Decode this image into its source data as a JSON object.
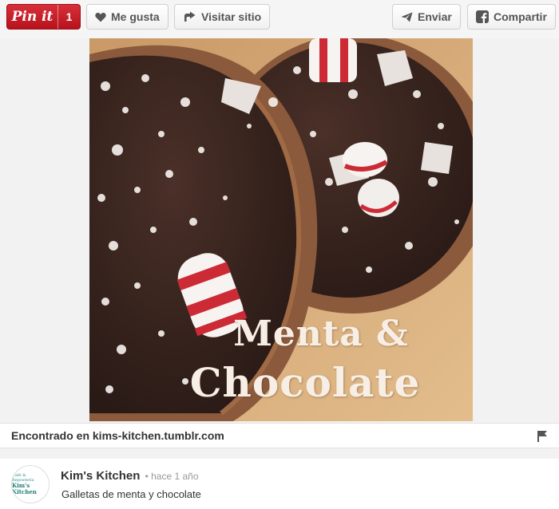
{
  "toolbar": {
    "pinit_label": "Pin it",
    "pinit_count": "1",
    "like_label": "Me gusta",
    "visit_label": "Visitar sitio",
    "send_label": "Enviar",
    "share_label": "Compartir"
  },
  "pin": {
    "overlay_line1": "Menta &",
    "overlay_line2": "Chocolate",
    "source_text": "Encontrado en kims-kitchen.tumblr.com"
  },
  "pinner": {
    "name": "Kim's Kitchen",
    "time": "• hace 1 año",
    "description": "Galletas de menta y chocolate",
    "avatar_small_text": "Café & Repostería",
    "avatar_main_text": "Kim's Kitchen"
  },
  "colors": {
    "pinit_red": "#c8232c",
    "chocolate": "#3a2620",
    "cookie": "#8b5a3c",
    "board": "#d3a776"
  }
}
